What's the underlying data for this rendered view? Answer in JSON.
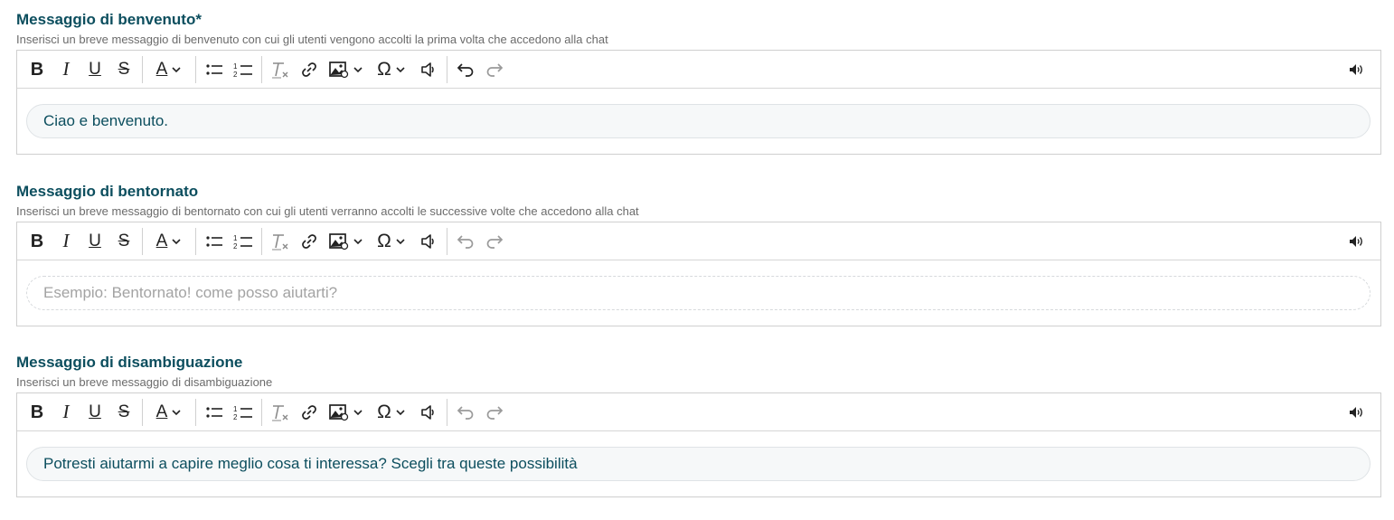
{
  "sections": [
    {
      "title": "Messaggio di benvenuto*",
      "description": "Inserisci un breve messaggio di benvenuto con cui gli utenti vengono accolti la prima volta che accedono alla chat",
      "value": "Ciao e benvenuto.",
      "placeholder": "",
      "undo_enabled": true
    },
    {
      "title": "Messaggio di bentornato",
      "description": "Inserisci un breve messaggio di bentornato con cui gli utenti verranno accolti le successive volte che accedono alla chat",
      "value": "",
      "placeholder": "Esempio: Bentornato! come posso aiutarti?",
      "undo_enabled": false
    },
    {
      "title": "Messaggio di disambiguazione",
      "description": "Inserisci un breve messaggio di disambiguazione",
      "value": "Potresti aiutarmi a capire meglio cosa ti interessa? Scegli tra queste possibilità",
      "placeholder": "",
      "undo_enabled": false
    }
  ],
  "toolbar": {
    "bold": "B",
    "italic": "I",
    "underline": "U",
    "strike": "S",
    "font_color": "A",
    "special_char": "Ω",
    "icons": [
      "bold-icon",
      "italic-icon",
      "underline-icon",
      "strikethrough-icon",
      "font-color-icon",
      "bullet-list-icon",
      "numbered-list-icon",
      "clear-format-icon",
      "link-icon",
      "image-icon",
      "special-char-icon",
      "speaker-icon",
      "undo-icon",
      "redo-icon",
      "text-to-speech-icon"
    ]
  },
  "colors": {
    "title": "#0c4e5e",
    "desc": "#6b6b6b",
    "content_text": "#0c4e5e",
    "placeholder": "#a3a3a3",
    "toolbar_icon": "#222222",
    "disabled_icon": "#9a9a9a"
  }
}
